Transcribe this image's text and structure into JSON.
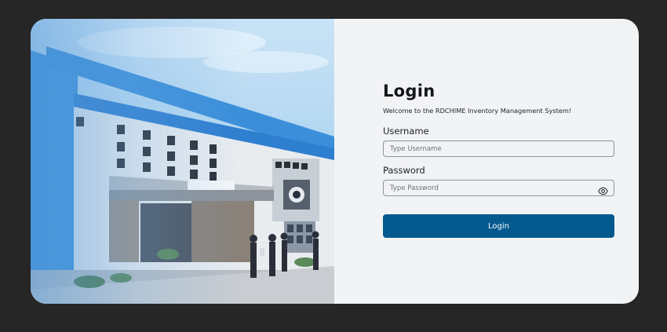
{
  "login": {
    "title": "Login",
    "welcome": "Welcome to the RDCHIME Inventory Management System!",
    "username": {
      "label": "Username",
      "placeholder": "Type Username",
      "value": ""
    },
    "password": {
      "label": "Password",
      "placeholder": "Type Password",
      "value": "",
      "toggle_icon": "eye-icon"
    },
    "submit_label": "Login"
  },
  "colors": {
    "page_background": "#262626",
    "card_background": "#f2f3f5",
    "primary_button": "#045a8f"
  }
}
